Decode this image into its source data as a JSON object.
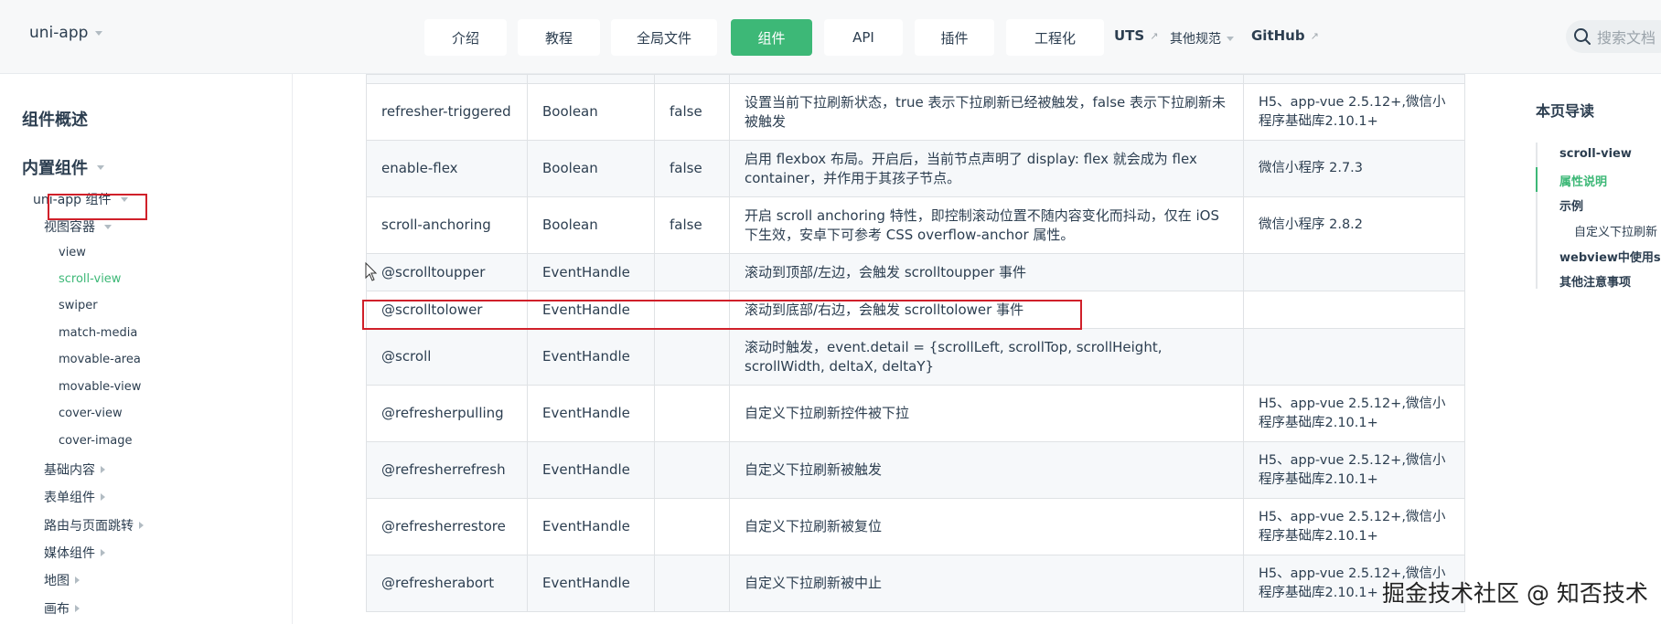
{
  "brand": "uni-app",
  "nav": {
    "buttons": [
      "介绍",
      "教程",
      "全局文件",
      "组件",
      "API",
      "插件",
      "工程化"
    ],
    "uts": "UTS",
    "other_specs": "其他规范",
    "github": "GitHub",
    "search_placeholder": "搜索文档"
  },
  "sidebar": {
    "overview": "组件概述",
    "builtin": "内置组件",
    "uniapp_components": "uni-app 组件",
    "view_container": "视图容器",
    "view_items": [
      "view",
      "scroll-view",
      "swiper",
      "match-media",
      "movable-area",
      "movable-view",
      "cover-view",
      "cover-image"
    ],
    "categories": [
      "基础内容",
      "表单组件",
      "路由与页面跳转",
      "媒体组件",
      "地图",
      "画布"
    ]
  },
  "table": {
    "rows": [
      [
        "refresher-triggered",
        "Boolean",
        "false",
        "设置当前下拉刷新状态，true 表示下拉刷新已经被触发，false 表示下拉刷新未被触发",
        "H5、app-vue 2.5.12+,微信小程序基础库2.10.1+"
      ],
      [
        "enable-flex",
        "Boolean",
        "false",
        "启用 flexbox 布局。开启后，当前节点声明了 display: flex 就会成为 flex container，并作用于其孩子节点。",
        "微信小程序 2.7.3"
      ],
      [
        "scroll-anchoring",
        "Boolean",
        "false",
        "开启 scroll anchoring 特性，即控制滚动位置不随内容变化而抖动，仅在 iOS 下生效，安卓下可参考 CSS overflow-anchor 属性。",
        "微信小程序 2.8.2"
      ],
      [
        "@scrolltoupper",
        "EventHandle",
        "",
        "滚动到顶部/左边，会触发 scrolltoupper 事件",
        ""
      ],
      [
        "@scrolltolower",
        "EventHandle",
        "",
        "滚动到底部/右边，会触发 scrolltolower 事件",
        ""
      ],
      [
        "@scroll",
        "EventHandle",
        "",
        "滚动时触发，event.detail = {scrollLeft, scrollTop, scrollHeight, scrollWidth, deltaX, deltaY}",
        ""
      ],
      [
        "@refresherpulling",
        "EventHandle",
        "",
        "自定义下拉刷新控件被下拉",
        "H5、app-vue 2.5.12+,微信小程序基础库2.10.1+"
      ],
      [
        "@refresherrefresh",
        "EventHandle",
        "",
        "自定义下拉刷新被触发",
        "H5、app-vue 2.5.12+,微信小程序基础库2.10.1+"
      ],
      [
        "@refresherrestore",
        "EventHandle",
        "",
        "自定义下拉刷新被复位",
        "H5、app-vue 2.5.12+,微信小程序基础库2.10.1+"
      ],
      [
        "@refresherabort",
        "EventHandle",
        "",
        "自定义下拉刷新被中止",
        "H5、app-vue 2.5.12+,微信小程序基础库2.10.1+"
      ]
    ]
  },
  "toc": {
    "title": "本页导读",
    "items": [
      "scroll-view",
      "属性说明",
      "示例",
      "自定义下拉刷新",
      "webview中使用scroll-view",
      "其他注意事项"
    ]
  },
  "watermark": "掘金技术社区 @ 知否技术",
  "colors": {
    "accent": "#3db877",
    "highlight": "#d0202a"
  }
}
